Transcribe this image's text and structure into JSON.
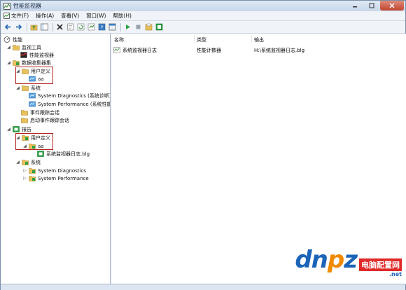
{
  "window": {
    "title": "性能监视器"
  },
  "menu": [
    {
      "label": "文件(F)"
    },
    {
      "label": "操作(A)"
    },
    {
      "label": "查看(V)"
    },
    {
      "label": "窗口(W)"
    },
    {
      "label": "帮助(H)"
    }
  ],
  "tree": {
    "root": "性能",
    "monitoring_tools": "监视工具",
    "perf_monitor": "性能监视器",
    "data_collector_sets": "数据收集器集",
    "user_defined": "用户定义",
    "aa": "aa",
    "system": "系统",
    "sys_diagnostics": "System Diagnostics (系统诊断)",
    "sys_performance": "System Performance (系统性能",
    "event_trace": "事件跟踪会话",
    "startup_trace": "启动事件跟踪会话",
    "reports": "报告",
    "rep_user_defined": "用户定义",
    "rep_aa": "aa",
    "rep_log": "系统监视器日志.blg",
    "rep_system": "系统",
    "rep_sys_diag": "System Diagnostics",
    "rep_sys_perf": "System Performance"
  },
  "list": {
    "columns": [
      "名称",
      "类型",
      "输出"
    ],
    "rows": [
      {
        "name": "系统监视器日志",
        "type": "性能计数器",
        "output": "H:\\系统监视器日志.blg"
      }
    ]
  },
  "watermark": {
    "logo": "dnpz",
    "logo_a": "dn",
    "logo_o": "p",
    "logo_b": "z",
    "net": ".net",
    "chinese": "电脑配置网",
    "domain": ".net"
  }
}
